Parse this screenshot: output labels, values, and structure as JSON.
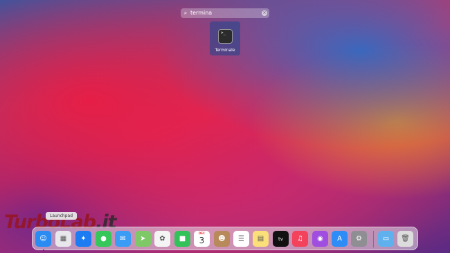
{
  "search": {
    "query": "termina"
  },
  "result": {
    "label": "Terminale",
    "icon_glyph": ">_"
  },
  "tooltip": {
    "text": "Launchpad"
  },
  "watermark": {
    "text_red": "TurboLab",
    "text_dark": ".it"
  },
  "calendar": {
    "month": "DEC",
    "day": "3"
  },
  "dock": {
    "apps": [
      {
        "name": "finder",
        "icon": "finder-icon",
        "glyph": "☺",
        "color": "#2a8bf2"
      },
      {
        "name": "launchpad",
        "icon": "launchpad-icon",
        "glyph": "▦",
        "color": "#e7e7ec"
      },
      {
        "name": "safari",
        "icon": "safari-icon",
        "glyph": "✦",
        "color": "#1d7cf2"
      },
      {
        "name": "messages",
        "icon": "messages-icon",
        "glyph": "●",
        "color": "#35c759"
      },
      {
        "name": "mail",
        "icon": "mail-icon",
        "glyph": "✉",
        "color": "#3a9cf5"
      },
      {
        "name": "maps",
        "icon": "maps-icon",
        "glyph": "➤",
        "color": "#7ec867"
      },
      {
        "name": "photos",
        "icon": "photos-icon",
        "glyph": "✿",
        "color": "#f4f4f4"
      },
      {
        "name": "facetime",
        "icon": "facetime-icon",
        "glyph": "■",
        "color": "#33c15a"
      },
      {
        "name": "calendar",
        "icon": "calendar-icon",
        "glyph": "",
        "color": "#ffffff"
      },
      {
        "name": "contacts",
        "icon": "contacts-icon",
        "glyph": "☻",
        "color": "#b8895a"
      },
      {
        "name": "reminders",
        "icon": "reminders-icon",
        "glyph": "☰",
        "color": "#ffffff"
      },
      {
        "name": "notes",
        "icon": "notes-icon",
        "glyph": "▤",
        "color": "#fbe07a"
      },
      {
        "name": "tv",
        "icon": "appletv-icon",
        "glyph": "tv",
        "color": "#111111"
      },
      {
        "name": "music",
        "icon": "music-icon",
        "glyph": "♫",
        "color": "#f3425c"
      },
      {
        "name": "podcasts",
        "icon": "podcasts-icon",
        "glyph": "◉",
        "color": "#9f4ee0"
      },
      {
        "name": "appstore",
        "icon": "appstore-icon",
        "glyph": "A",
        "color": "#2d8cf5"
      },
      {
        "name": "preferences",
        "icon": "gear-icon",
        "glyph": "⚙",
        "color": "#8e8e93"
      },
      {
        "name": "downloads",
        "icon": "folder-icon",
        "glyph": "▭",
        "color": "#5fb1ee"
      },
      {
        "name": "trash",
        "icon": "trash-icon",
        "glyph": "🗑",
        "color": "#dcdcdc"
      }
    ]
  }
}
